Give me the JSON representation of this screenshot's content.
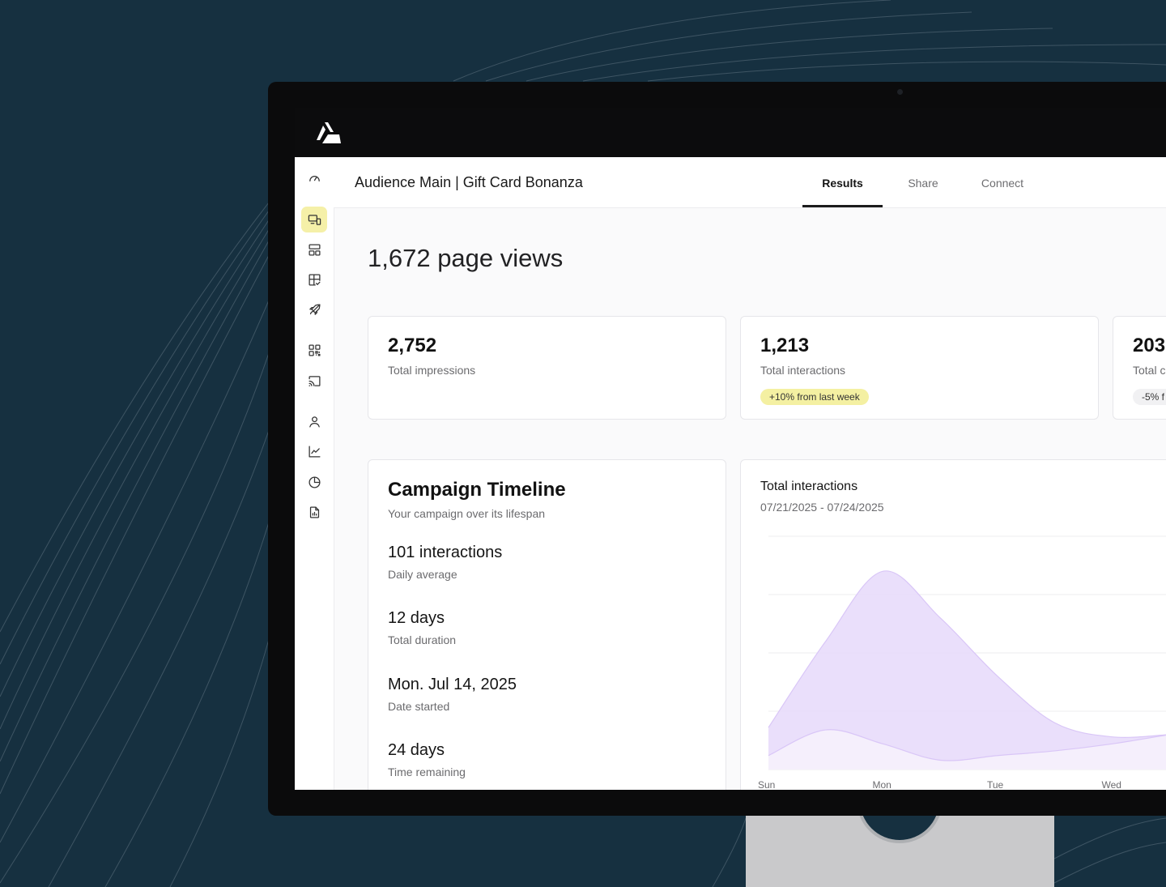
{
  "app": {
    "logo_icon": "brand-logo-icon"
  },
  "header": {
    "title": "Audience Main | Gift Card Bonanza",
    "tabs": [
      {
        "label": "Results",
        "active": true
      },
      {
        "label": "Share",
        "active": false
      },
      {
        "label": "Connect",
        "active": false
      }
    ]
  },
  "sidebar": {
    "items": [
      {
        "icon": "gauge-icon",
        "active": false
      },
      {
        "icon": "devices-icon",
        "active": true
      },
      {
        "icon": "layout-icon",
        "active": false
      },
      {
        "icon": "board-check-icon",
        "active": false
      },
      {
        "icon": "rocket-icon",
        "active": false
      },
      {
        "icon": "qr-code-icon",
        "active": false
      },
      {
        "icon": "cast-icon",
        "active": false
      },
      {
        "icon": "user-icon",
        "active": false
      },
      {
        "icon": "line-chart-icon",
        "active": false
      },
      {
        "icon": "pie-chart-icon",
        "active": false
      },
      {
        "icon": "report-icon",
        "active": false
      }
    ]
  },
  "main": {
    "headline": "1,672 page views",
    "stats": [
      {
        "value": "2,752",
        "label": "Total impressions",
        "badge": ""
      },
      {
        "value": "1,213",
        "label": "Total interactions",
        "badge": "+10% from last week"
      },
      {
        "value": "203",
        "label": "Total c",
        "badge": "-5% f"
      }
    ],
    "timeline": {
      "title": "Campaign Timeline",
      "subtitle": "Your campaign over its lifespan",
      "items": [
        {
          "value": "101 interactions",
          "label": "Daily average"
        },
        {
          "value": "12 days",
          "label": "Total duration"
        },
        {
          "value": "Mon. Jul 14, 2025",
          "label": "Date started"
        },
        {
          "value": "24 days",
          "label": "Time remaining"
        }
      ]
    },
    "chart_card": {
      "title": "Total interactions",
      "range": "07/21/2025 - 07/24/2025"
    }
  },
  "colors": {
    "background": "#163040",
    "accent_yellow": "#f4f0a2",
    "area_primary": "#e8dbfb",
    "area_secondary": "#f5effc",
    "area_stroke": "#d9c6f7"
  },
  "chart_data": {
    "type": "area",
    "title": "Total interactions",
    "categories": [
      "Sun",
      "Mon",
      "Tue",
      "Wed"
    ],
    "ylim": [
      0,
      100
    ],
    "grid": true,
    "legend": "none",
    "x": [
      0,
      0.5,
      1,
      1.5,
      2,
      2.5,
      3,
      3.5
    ],
    "series": [
      {
        "values": [
          18,
          55,
          85,
          65,
          40,
          20,
          14,
          15
        ]
      },
      {
        "values": [
          6,
          17,
          11,
          4,
          6,
          8,
          11,
          15
        ]
      }
    ]
  }
}
